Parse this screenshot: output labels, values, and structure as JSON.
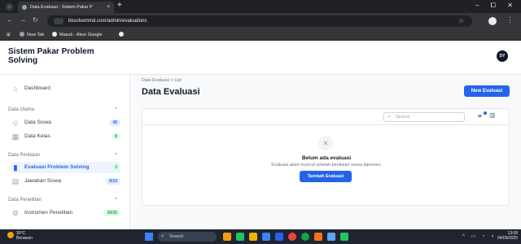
{
  "browser": {
    "tab_title": "Data Evaluasi - Sistem Pakar P",
    "tab_close": "×",
    "new_tab": "+",
    "tab_menu": "⌄",
    "window_controls": [
      "–",
      "⧠",
      "✕"
    ],
    "back": "←",
    "forward": "→",
    "reload": "↻",
    "url": "bksolvemind.com/admin/evaluations",
    "bookmarks": [
      "New Tab",
      "Masuk - Akun Google"
    ]
  },
  "app": {
    "brand": "Sistem Pakar Problem Solving",
    "avatar": "DY"
  },
  "sidebar": {
    "dashboard": "Dashboard",
    "sections": [
      {
        "label": "Data Utama",
        "items": [
          {
            "label": "Data Siswa",
            "badge": "45"
          },
          {
            "label": "Data Kelas",
            "badge": "8"
          }
        ]
      },
      {
        "label": "Data Penilaian",
        "items": [
          {
            "label": "Evaluasi Problem Solving",
            "badge": "3"
          },
          {
            "label": "Jawaban Siswa",
            "badge": "6/10"
          }
        ]
      },
      {
        "label": "Data Penelitian",
        "items": [
          {
            "label": "Instrumen Penelitian",
            "badge": "35/35"
          }
        ]
      }
    ]
  },
  "main": {
    "breadcrumb": "Data Evaluasi  >  List",
    "title": "Data Evaluasi",
    "new_button": "New Evaluasi",
    "search_placeholder": "Search",
    "empty_title": "Belum ada evaluasi",
    "empty_desc": "Evaluasi akan muncul setelah penilaian siswa diproses.",
    "add_button": "Tambah Evaluasi"
  },
  "taskbar": {
    "weather_temp": "30°C",
    "weather_desc": "Berawan",
    "search": "Search",
    "time": "13:08",
    "date": "04/09/2025"
  },
  "colors": {
    "accent": "#2563eb"
  }
}
